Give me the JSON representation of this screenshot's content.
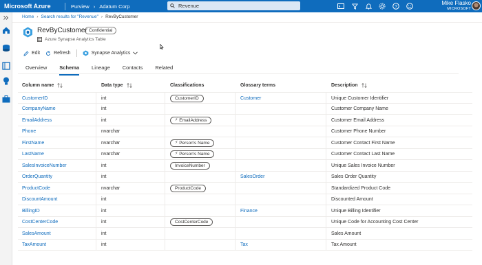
{
  "topbar": {
    "brand": "Microsoft Azure",
    "breadcrumb": [
      "Purview",
      "Adatum Corp"
    ],
    "search_value": "Revenue",
    "user_name": "Mike Flasko",
    "user_org": "MICROSOFT"
  },
  "breadcrumb": {
    "home": "Home",
    "search": "Search results for \"Revenue\"",
    "current": "RevByCustomer"
  },
  "asset": {
    "title": "RevByCustomer",
    "badge": "Confidential",
    "subtitle": "Azure Synapse Analytics Table"
  },
  "commands": {
    "edit": "Edit",
    "refresh": "Refresh",
    "synapse": "Synapse Analytics"
  },
  "tabs": [
    "Overview",
    "Schema",
    "Lineage",
    "Contacts",
    "Related"
  ],
  "active_tab": "Schema",
  "table": {
    "headers": {
      "name": "Column name",
      "type": "Data type",
      "class": "Classifications",
      "gloss": "Glossary terms",
      "desc": "Description"
    },
    "rows": [
      {
        "name": "CustomerID",
        "type": "int",
        "class": "CustomerID",
        "class_auto": false,
        "gloss": "Customer",
        "desc": "Unique Customer Identifier"
      },
      {
        "name": "CompanyName",
        "type": "int",
        "class": "",
        "class_auto": false,
        "gloss": "",
        "desc": "Customer Company Name"
      },
      {
        "name": "EmailAddress",
        "type": "int",
        "class": "EmailAddress",
        "class_auto": true,
        "gloss": "",
        "desc": "Customer Email Address"
      },
      {
        "name": "Phone",
        "type": "nvarchar",
        "class": "",
        "class_auto": false,
        "gloss": "",
        "desc": "Customer Phone Number"
      },
      {
        "name": "FirstName",
        "type": "nvarchar",
        "class": "Person's Name",
        "class_auto": true,
        "gloss": "",
        "desc": "Customer Contact First Name"
      },
      {
        "name": "LastName",
        "type": "nvarchar",
        "class": "Person's Name",
        "class_auto": true,
        "gloss": "",
        "desc": "Customer Contact Last Name"
      },
      {
        "name": "SalesInvoiceNumber",
        "type": "int",
        "class": "InvoiceNumber",
        "class_auto": false,
        "gloss": "",
        "desc": "Unique Sales Invoice Number"
      },
      {
        "name": "OrderQuantity",
        "type": "int",
        "class": "",
        "class_auto": false,
        "gloss": "SalesOrder",
        "desc": "Sales Order Quantity"
      },
      {
        "name": "ProductCode",
        "type": "nvarchar",
        "class": "ProductCode",
        "class_auto": false,
        "gloss": "",
        "desc": "Standardized Product Code"
      },
      {
        "name": "DiscountAmount",
        "type": "int",
        "class": "",
        "class_auto": false,
        "gloss": "",
        "desc": "Discounted Amount"
      },
      {
        "name": "BillingID",
        "type": "int",
        "class": "",
        "class_auto": false,
        "gloss": "Finance",
        "desc": "Unique Billing Identifier"
      },
      {
        "name": "CostCenterCode",
        "type": "int",
        "class": "CostCenterCode",
        "class_auto": false,
        "gloss": "",
        "desc": "Unique Code for Accounting Cost Center"
      },
      {
        "name": "SalesAmount",
        "type": "int",
        "class": "",
        "class_auto": false,
        "gloss": "",
        "desc": "Sales Amount"
      },
      {
        "name": "TaxAmount",
        "type": "int",
        "class": "",
        "class_auto": false,
        "gloss": "Tax",
        "desc": "Tax Amount"
      }
    ]
  }
}
